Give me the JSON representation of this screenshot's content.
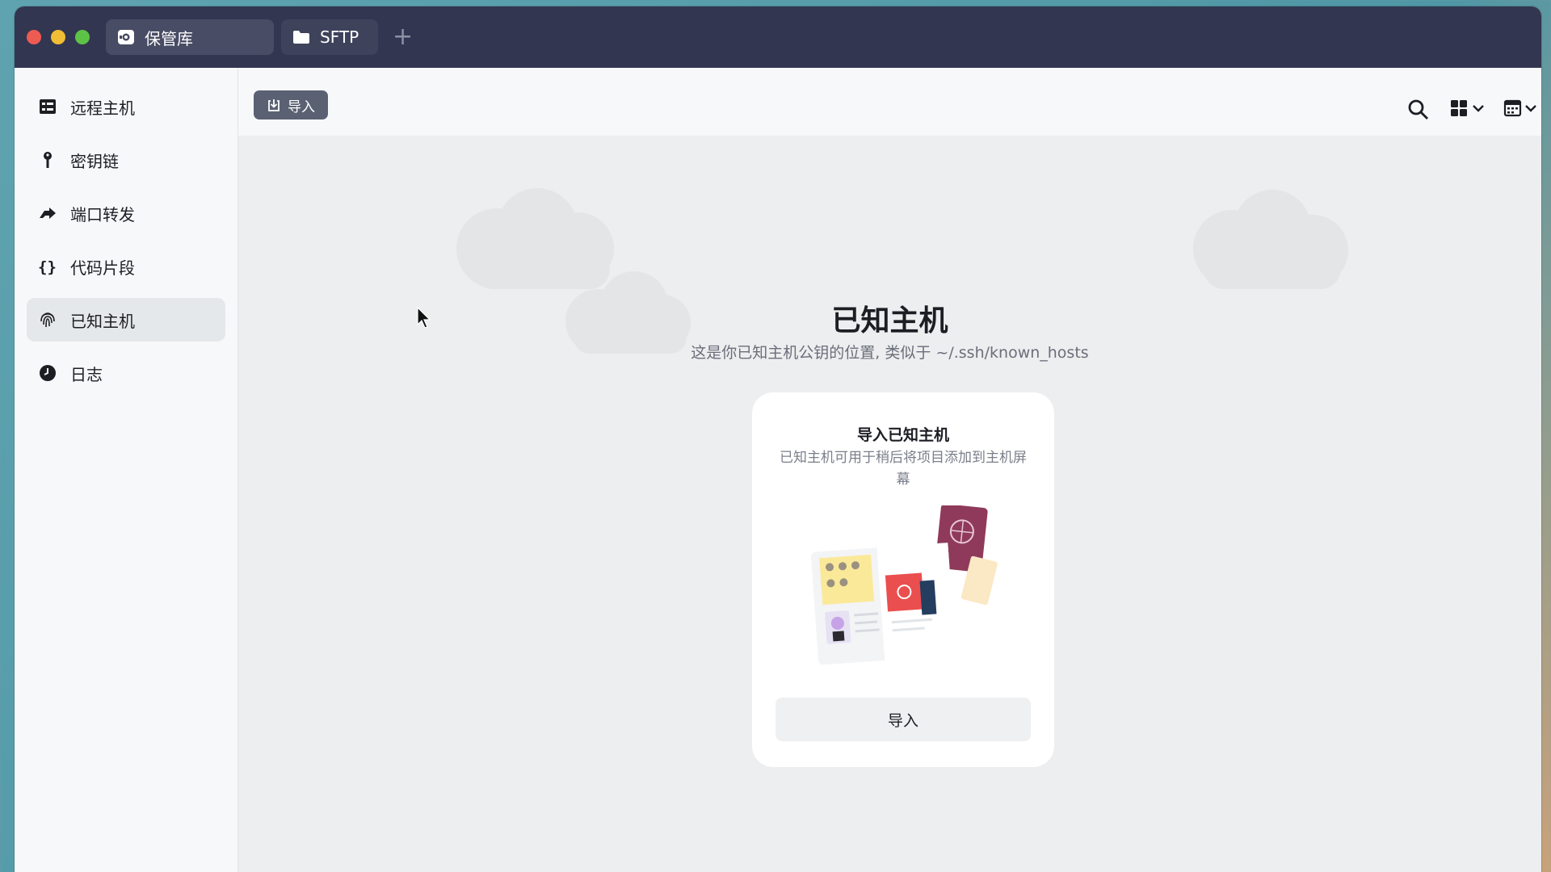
{
  "window": {
    "tabs": [
      {
        "label": "保管库",
        "icon": "vault-icon"
      },
      {
        "label": "SFTP",
        "icon": "folder-icon"
      }
    ],
    "add_tab_label": "+"
  },
  "sidebar": {
    "items": [
      {
        "label": "远程主机",
        "icon": "server-grid-icon",
        "active": false
      },
      {
        "label": "密钥链",
        "icon": "key-icon",
        "active": false
      },
      {
        "label": "端口转发",
        "icon": "forward-arrow-icon",
        "active": false
      },
      {
        "label": "代码片段",
        "icon": "braces-icon",
        "active": false
      },
      {
        "label": "已知主机",
        "icon": "fingerprint-icon",
        "active": true
      },
      {
        "label": "日志",
        "icon": "clock-icon",
        "active": false
      }
    ]
  },
  "toolbar": {
    "import_label": "导入",
    "icons": [
      "search-icon",
      "grid-view-icon",
      "calendar-sort-icon"
    ]
  },
  "main": {
    "title": "已知主机",
    "subtitle": "这是你已知主机公钥的位置, 类似于 ~/.ssh/known_hosts",
    "card": {
      "title": "导入已知主机",
      "description": "已知主机可用于稍后将项目添加到主机屏幕",
      "button_label": "导入"
    }
  },
  "colors": {
    "titlebar": "#323650",
    "sidebar_bg": "#f7f8f9",
    "content_bg": "#eceeef",
    "import_button": "#5a6173",
    "active_item": "#e5e8eb"
  }
}
